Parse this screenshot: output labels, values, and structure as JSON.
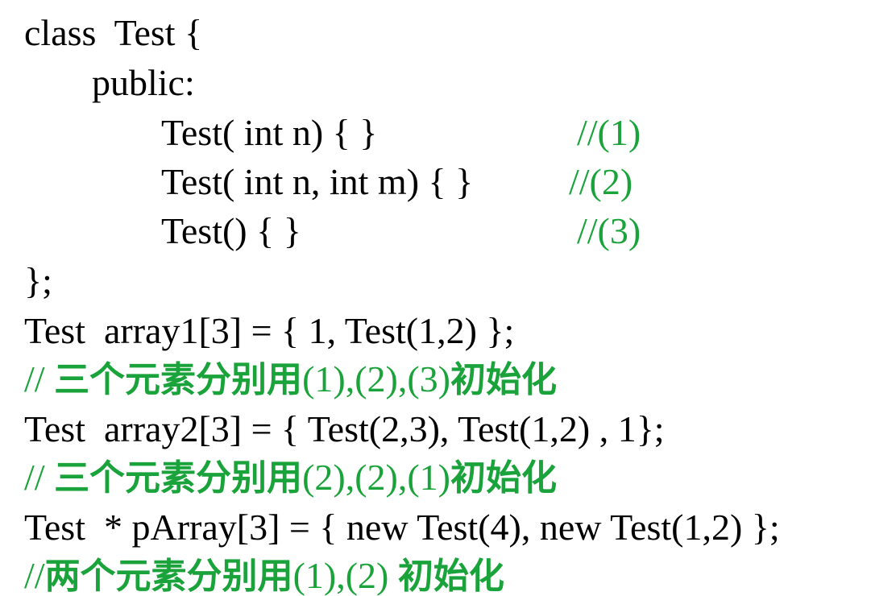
{
  "colors": {
    "code_text": "#000000",
    "comment_text": "#1aa33a",
    "background": "#ffffff"
  },
  "code": {
    "class_header": "class  Test {",
    "public_label": "public:",
    "constructors": [
      {
        "signature": "Test( int n) { }",
        "comment": "//(1)"
      },
      {
        "signature": "Test( int n, int m) { }",
        "comment": "//(2)"
      },
      {
        "signature": "Test() { }",
        "comment": "//(3)"
      }
    ],
    "class_close": "};",
    "statements": [
      {
        "code": "Test  array1[3] = { 1, Test(1,2) };",
        "comment_prefix": "// ",
        "comment_text": "三个元素分别用",
        "comment_refs": "(1),(2),(3)",
        "comment_suffix": "初始化"
      },
      {
        "code": "Test  array2[3] = { Test(2,3), Test(1,2) , 1};",
        "comment_prefix": "// ",
        "comment_text": "三个元素分别用",
        "comment_refs": "(2),(2),(1)",
        "comment_suffix": "初始化"
      },
      {
        "code": "Test  * pArray[3] = { new Test(4), new Test(1,2) };",
        "comment_prefix": "//",
        "comment_text": "两个元素分别用",
        "comment_refs": "(1),(2) ",
        "comment_suffix": "初始化"
      }
    ]
  }
}
